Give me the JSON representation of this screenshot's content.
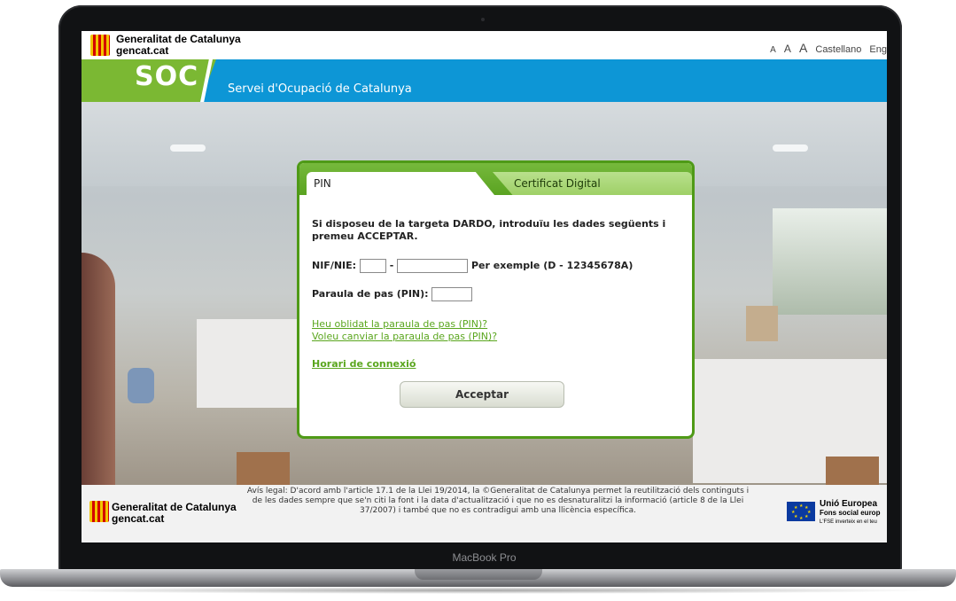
{
  "device": {
    "brand_label": "MacBook Pro"
  },
  "header": {
    "org_name": "Generalitat de Catalunya",
    "org_site": "gencat.cat",
    "font_sizes": [
      "A",
      "A",
      "A"
    ],
    "languages": [
      "Castellano",
      "Eng"
    ],
    "service_acronym": "SOC",
    "service_name": "Servei d'Ocupació de Catalunya"
  },
  "login": {
    "tabs": [
      {
        "label": "PIN",
        "active": true
      },
      {
        "label": "Certificat Digital",
        "active": false
      }
    ],
    "intro": "Si disposeu de la targeta DARDO, introduïu les dades següents i premeu ACCEPTAR.",
    "nif_label": "NIF/NIE:",
    "nif_separator": "-",
    "nif_example": "Per exemple (D - 12345678A)",
    "nif_prefix_value": "",
    "nif_number_value": "",
    "pin_label": "Paraula de pas (PIN):",
    "pin_value": "",
    "links": {
      "forgot_pin": "Heu oblidat la paraula de pas (PIN)?",
      "change_pin": "Voleu canviar la paraula de pas (PIN)?",
      "schedule": "Horari de connexió"
    },
    "submit_label": "Acceptar"
  },
  "footer": {
    "org_name": "Generalitat de Catalunya",
    "org_site": "gencat.cat",
    "legal": "Avís legal: D'acord amb l'article 17.1 de la Llei 19/2014, la ©Generalitat de Catalunya permet la reutilització dels continguts i de les dades sempre que se'n citi la font i la data d'actualització i que no es desnaturalitzi la informació (article 8 de la Llei 37/2007) i també que no es contradigui amb una llicència específica.",
    "eu_title": "Unió Europea",
    "eu_fund": "Fons social europ",
    "eu_tagline": "L'FSE inverteix en el teu"
  },
  "colors": {
    "banner_blue": "#0d96d6",
    "banner_green": "#7bb833",
    "panel_green": "#4f9a17",
    "link_green": "#5aa61e"
  }
}
